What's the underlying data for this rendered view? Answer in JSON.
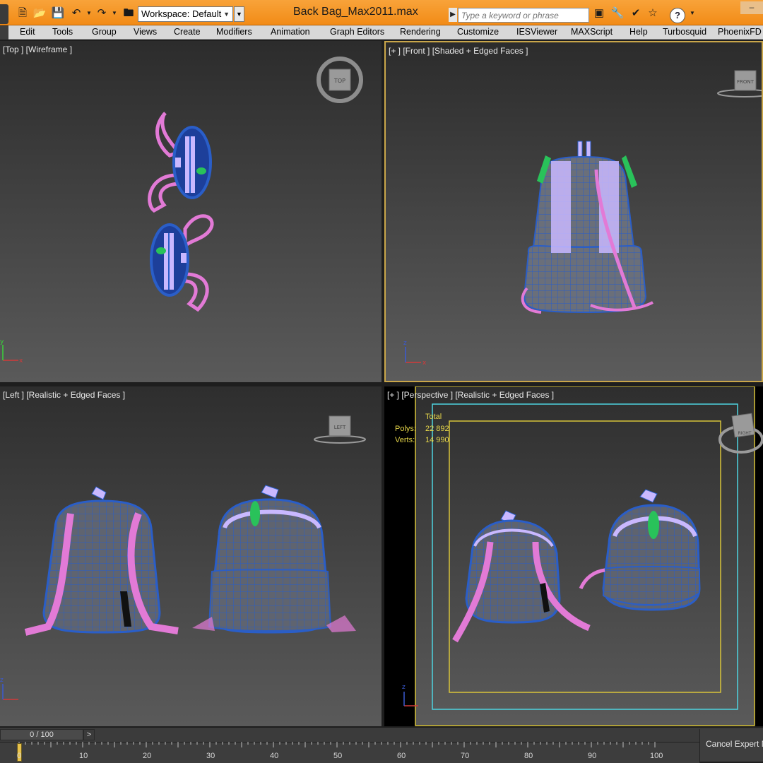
{
  "window": {
    "title": "Back Bag_Max2011.max",
    "workspace": "Workspace: Default",
    "search_placeholder": "Type a keyword or phrase",
    "help_label": "?",
    "minimize_label": "–"
  },
  "toolbar_icons": [
    "new-file-icon",
    "open-folder-icon",
    "save-icon",
    "undo-icon",
    "redo-icon",
    "project-folder-icon",
    "binoculars-icon",
    "tools-icon",
    "pin-icon",
    "favorite-star-icon"
  ],
  "menu": {
    "items": [
      "Edit",
      "Tools",
      "Group",
      "Views",
      "Create",
      "Modifiers",
      "Animation",
      "Graph Editors",
      "Rendering",
      "Customize",
      "IESViewer",
      "MAXScript",
      "Help",
      "Turbosquid",
      "PhoenixFD"
    ]
  },
  "viewports": {
    "top": {
      "label": "[Top ] [Wireframe ]",
      "cube": "TOP"
    },
    "front": {
      "label": "[+ ] [Front ] [Shaded + Edged Faces ]",
      "cube": "FRONT"
    },
    "left": {
      "label": "[Left ] [Realistic + Edged Faces ]",
      "cube": "LEFT"
    },
    "perspective": {
      "label": "[+ ] [Perspective ] [Realistic + Edged Faces ]",
      "cube": "RIGHT"
    }
  },
  "stats": {
    "header": "Total",
    "polys_label": "Polys:",
    "polys_value": "22 892",
    "verts_label": "Verts:",
    "verts_value": "14 990"
  },
  "axis_labels": {
    "x": "x",
    "y": "y",
    "z": "z"
  },
  "timeline": {
    "frame_display": "0 / 100",
    "next_label": ">",
    "ticks": [
      "0",
      "10",
      "20",
      "30",
      "40",
      "50",
      "60",
      "70",
      "80",
      "90",
      "100"
    ],
    "cancel_expert": "Cancel Expert M"
  },
  "colors": {
    "title_bar": "#f28b17",
    "mesh_blue": "#2a5ec8",
    "strap_pink": "#e27ad6",
    "zipper_lilac": "#c9b8ff",
    "accent_green": "#29c25a",
    "safe_frame_yellow": "#d8c43a",
    "safe_frame_cyan": "#4ed4e0"
  }
}
